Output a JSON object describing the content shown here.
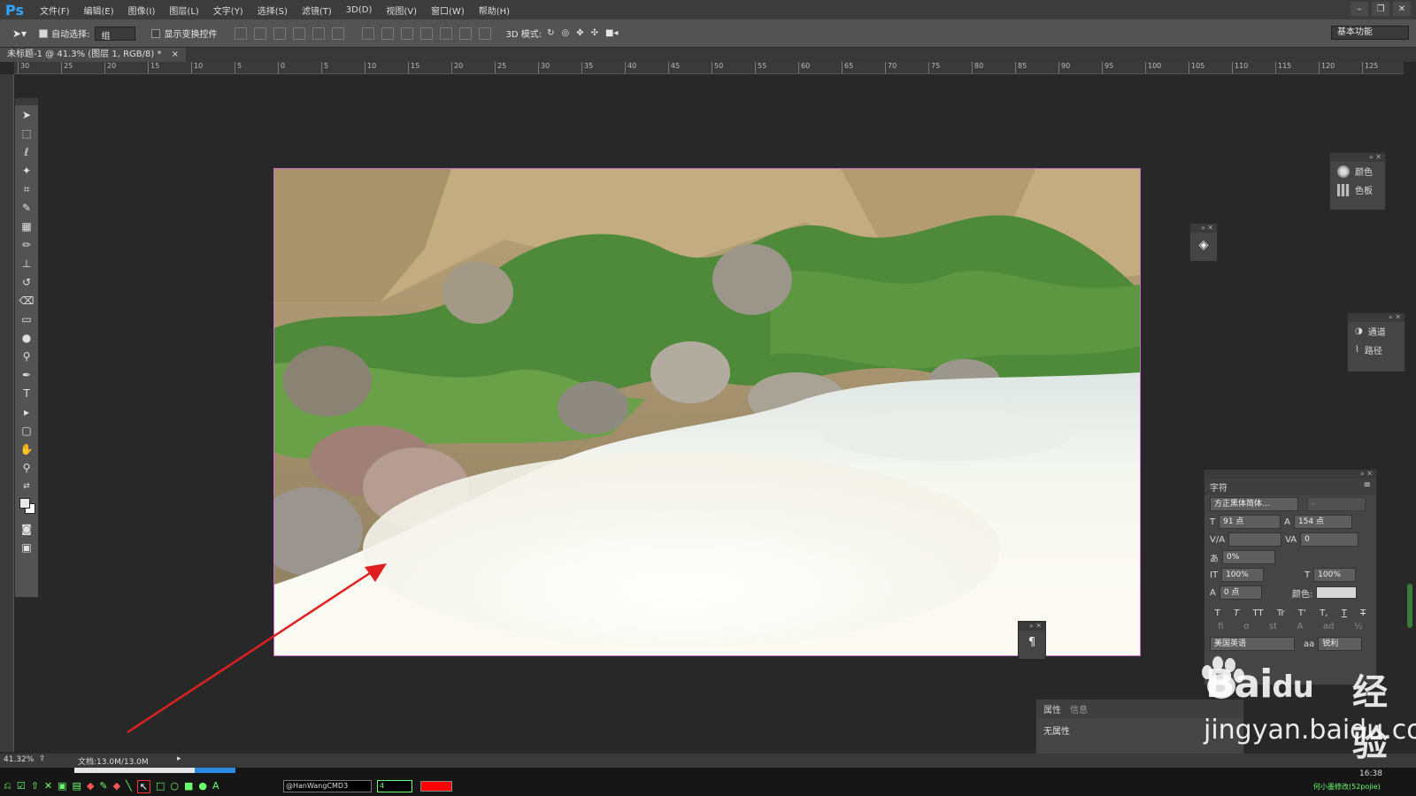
{
  "app": {
    "logo": "Ps",
    "menu": [
      "文件(F)",
      "编辑(E)",
      "图像(I)",
      "图层(L)",
      "文字(Y)",
      "选择(S)",
      "滤镜(T)",
      "3D(D)",
      "视图(V)",
      "窗口(W)",
      "帮助(H)"
    ]
  },
  "options": {
    "auto_select_label": "自动选择:",
    "auto_select_value": "组",
    "show_transform_label": "显示变换控件",
    "mode_3d_label": "3D 模式:",
    "workspace": "基本功能"
  },
  "document": {
    "tab_title": "未标题-1 @ 41.3% (图层 1, RGB/8) *",
    "zoom": "41.32%",
    "doc_size": "文档:13.0M/13.0M"
  },
  "ruler_labels": [
    "30",
    "25",
    "20",
    "15",
    "10",
    "5",
    "0",
    "5",
    "10",
    "15",
    "20",
    "25",
    "30",
    "35",
    "40",
    "45",
    "50",
    "55",
    "60",
    "65",
    "70",
    "75",
    "80",
    "85",
    "90",
    "95",
    "100",
    "105",
    "110",
    "115",
    "120",
    "125"
  ],
  "panels": {
    "color_label": "颜色",
    "swatches_label": "色板",
    "channels_label": "通道",
    "paths_label": "路径"
  },
  "character": {
    "title": "字符",
    "font_family": "方正黑体简体...",
    "font_style": "-",
    "size": "91 点",
    "leading": "154 点",
    "tracking": "0",
    "kerning": "",
    "scale_pct": "0%",
    "vscale": "100%",
    "hscale": "100%",
    "baseline": "0 点",
    "color_label": "颜色:",
    "language": "美国英语",
    "aa_label": "aa",
    "antialias": "锐利",
    "style_buttons": [
      "T",
      "T",
      "TT",
      "Tr",
      "T'",
      "T,",
      "T",
      "T"
    ]
  },
  "properties": {
    "tab1": "属性",
    "tab2": "信息",
    "content": "无属性"
  },
  "taskbar": {
    "font_field": "@HanWangCMD3",
    "size_field": "4",
    "clock": "16:38",
    "tray_text": "何小墨修改(52pojie)"
  },
  "watermark": {
    "brand": "Bai",
    "brand2": "du",
    "cn": "经验",
    "url": "jingyan.baidu.com"
  },
  "colors": {
    "accent": "#31a8ff",
    "canvas_border": "#c86cc8",
    "arrow": "#e02020",
    "swatch_red": "#ff0000"
  }
}
